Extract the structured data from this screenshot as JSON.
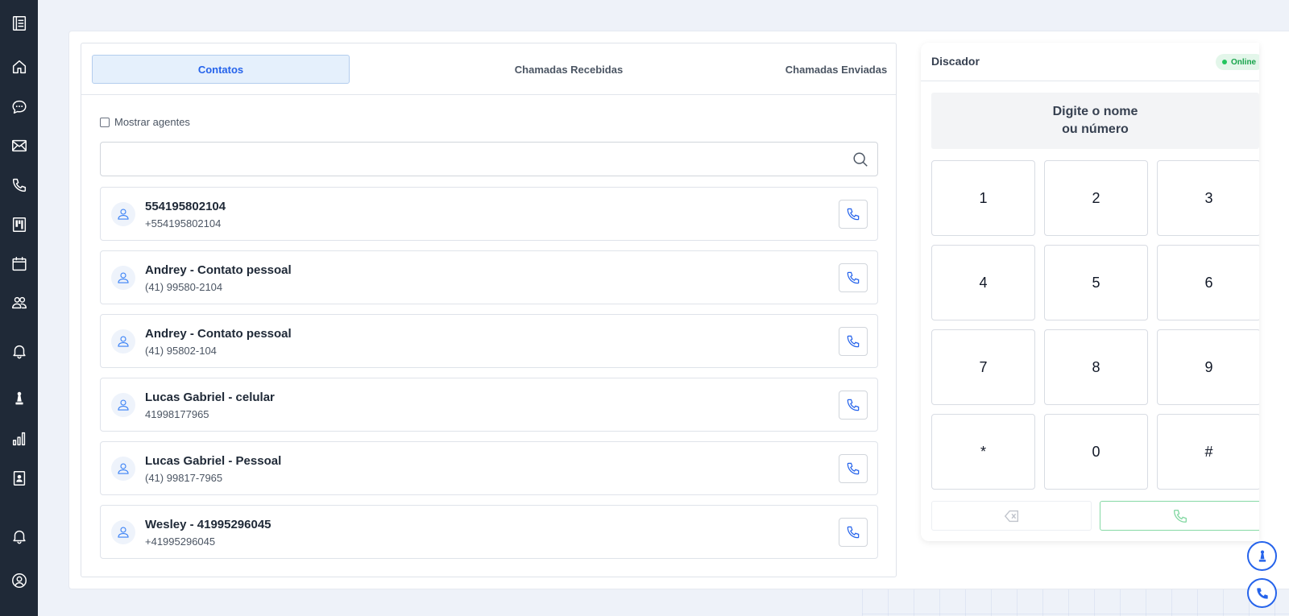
{
  "sidebar": {
    "items": [
      {
        "icon": "menu-list-icon"
      },
      {
        "icon": "home-icon"
      },
      {
        "icon": "chat-icon"
      },
      {
        "icon": "mail-icon"
      },
      {
        "icon": "phone-icon"
      },
      {
        "icon": "kanban-icon"
      },
      {
        "icon": "calendar-icon"
      },
      {
        "icon": "users-icon"
      },
      {
        "icon": "bell-icon"
      },
      {
        "icon": "pawn-icon"
      },
      {
        "icon": "bar-chart-icon"
      },
      {
        "icon": "contact-book-icon"
      },
      {
        "icon": "bell-icon"
      },
      {
        "icon": "user-circle-icon"
      }
    ]
  },
  "tabs": [
    {
      "label": "Contatos",
      "active": true
    },
    {
      "label": "Chamadas Recebidas",
      "active": false
    },
    {
      "label": "Chamadas Enviadas",
      "active": false
    }
  ],
  "show_agents": {
    "label": "Mostrar agentes",
    "checked": false
  },
  "search": {
    "value": "",
    "placeholder": ""
  },
  "contacts": [
    {
      "name": "554195802104",
      "number": "+554195802104"
    },
    {
      "name": "Andrey - Contato pessoal",
      "number": "(41) 99580-2104"
    },
    {
      "name": "Andrey - Contato pessoal",
      "number": "(41) 95802-104"
    },
    {
      "name": "Lucas Gabriel - celular",
      "number": "41998177965"
    },
    {
      "name": "Lucas Gabriel - Pessoal",
      "number": "(41) 99817-7965"
    },
    {
      "name": "Wesley - 41995296045",
      "number": "+41995296045"
    }
  ],
  "dialer": {
    "title": "Discador",
    "status": "Online",
    "display_text": "Digite o nome\nou número",
    "keys": [
      "1",
      "2",
      "3",
      "4",
      "5",
      "6",
      "7",
      "8",
      "9",
      "*",
      "0",
      "#"
    ]
  },
  "colors": {
    "sidebar": "#1f2937",
    "accent": "#2563eb",
    "online": "#22c55e"
  }
}
